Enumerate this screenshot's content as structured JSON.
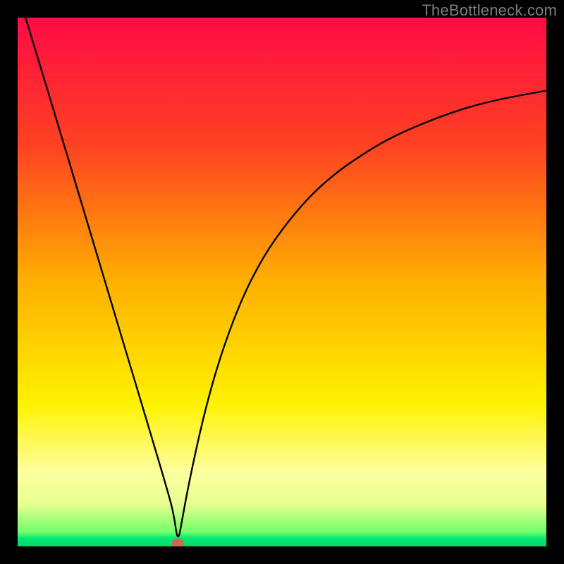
{
  "watermark": "TheBottleneck.com",
  "chart_data": {
    "type": "line",
    "title": "",
    "xlabel": "",
    "ylabel": "",
    "xlim": [
      0,
      100
    ],
    "ylim": [
      0,
      100
    ],
    "gradient_stops": [
      {
        "offset": 0,
        "color": "#ff0b46"
      },
      {
        "offset": 0.24,
        "color": "#ff4122"
      },
      {
        "offset": 0.5,
        "color": "#ffb000"
      },
      {
        "offset": 0.73,
        "color": "#fff200"
      },
      {
        "offset": 0.86,
        "color": "#fdffa0"
      },
      {
        "offset": 0.92,
        "color": "#e8ff90"
      },
      {
        "offset": 0.973,
        "color": "#70ff6a"
      },
      {
        "offset": 0.985,
        "color": "#00e874"
      },
      {
        "offset": 1.0,
        "color": "#00d96a"
      }
    ],
    "marker": {
      "x": 30.3,
      "y": 0.6,
      "color": "#c96a56"
    },
    "series": [
      {
        "name": "curve",
        "x": [
          1.5,
          5,
          10,
          15,
          20,
          23,
          26,
          28,
          29.5,
          30.3,
          31.1,
          32.5,
          35,
          38,
          42,
          46,
          50,
          55,
          60,
          65,
          70,
          75,
          80,
          85,
          90,
          95,
          100
        ],
        "y": [
          100,
          88.5,
          71.9,
          55.2,
          38.5,
          28.5,
          18.5,
          11.7,
          6.4,
          0.6,
          5.0,
          12.5,
          24.0,
          35.0,
          46.0,
          54.0,
          60.0,
          66.0,
          70.5,
          74.0,
          77.0,
          79.3,
          81.3,
          83.0,
          84.3,
          85.3,
          86.2
        ]
      }
    ]
  }
}
